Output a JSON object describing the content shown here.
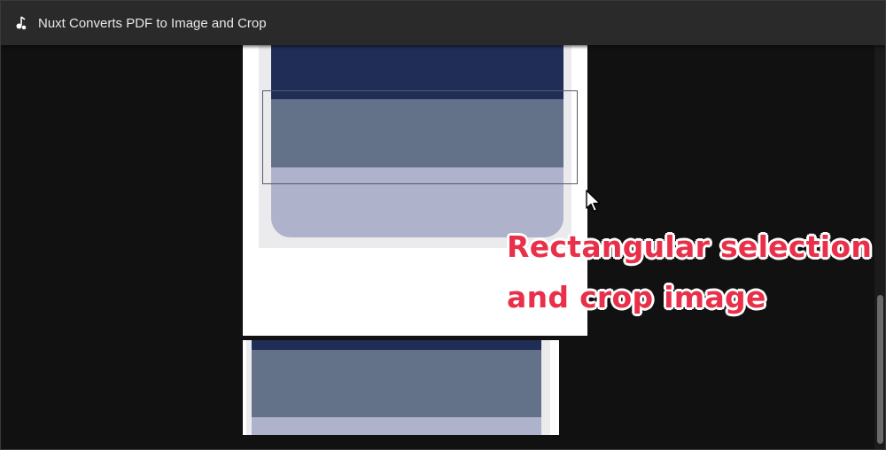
{
  "window": {
    "title": "Nuxt Converts PDF to Image and Crop",
    "icon": "music-note-icon"
  },
  "annotation": {
    "line1": "Rectangular selection",
    "line2": "and crop image",
    "color": "#e8304a"
  },
  "colors": {
    "background": "#111111",
    "titlebar": "#2a2a2a",
    "band_dark": "#1f2d57",
    "band_mid": "#637189",
    "band_light": "#aeb3cb"
  }
}
